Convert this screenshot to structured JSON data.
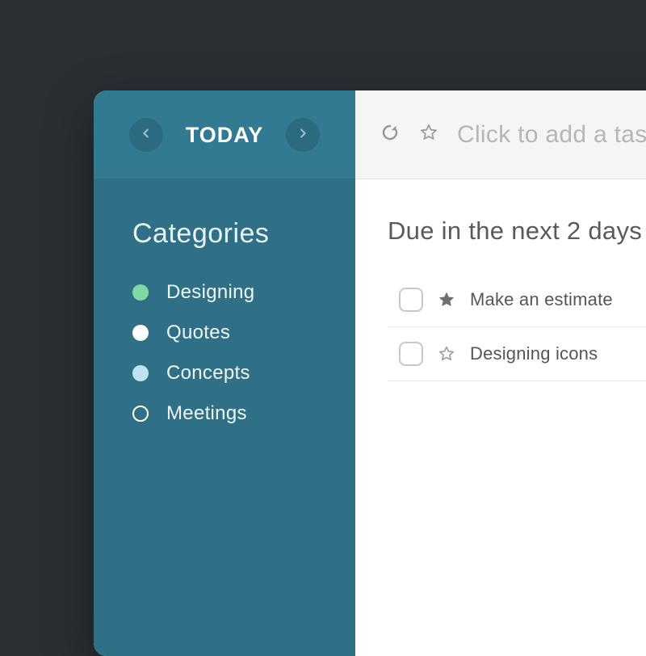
{
  "sidebar": {
    "title": "TODAY",
    "categories_heading": "Categories",
    "categories": [
      {
        "label": "Designing",
        "color": "#7fd9a3",
        "filled": true
      },
      {
        "label": "Quotes",
        "color": "#ffffff",
        "filled": true
      },
      {
        "label": "Concepts",
        "color": "#bfe4ef",
        "filled": true
      },
      {
        "label": "Meetings",
        "color": "#ffffff",
        "filled": false
      }
    ]
  },
  "header": {
    "add_placeholder": "Click to add a task"
  },
  "main": {
    "section_title": "Due in the next 2 days",
    "tasks": [
      {
        "label": "Make an estimate",
        "starred": true
      },
      {
        "label": "Designing icons",
        "starred": false
      }
    ]
  }
}
